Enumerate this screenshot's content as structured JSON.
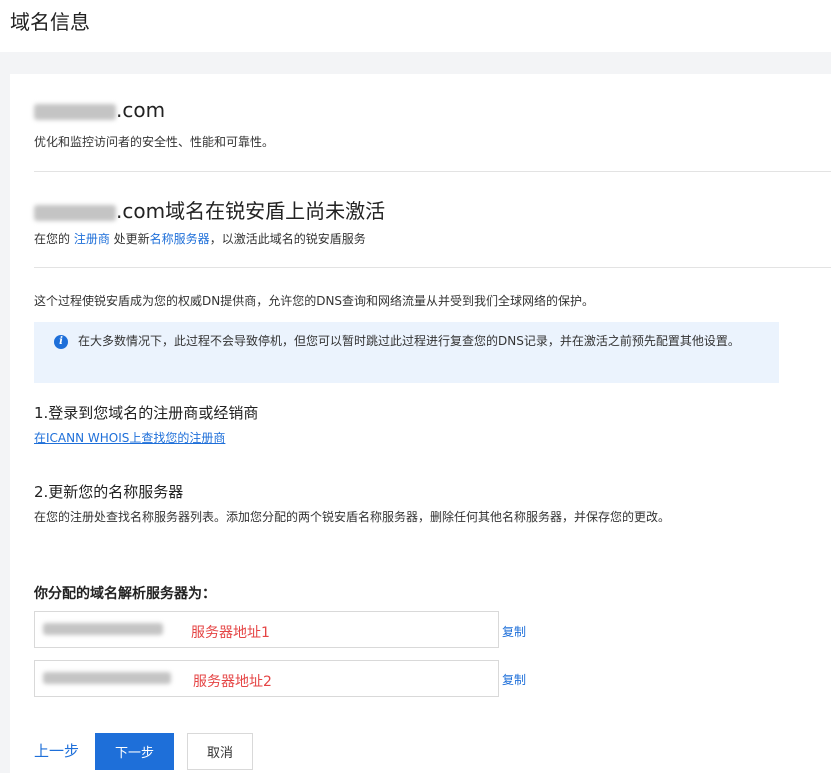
{
  "header": {
    "title": "域名信息"
  },
  "domain": {
    "name_suffix": ".com",
    "description": "优化和监控访问者的安全性、性能和可靠性。"
  },
  "status": {
    "title_suffix": ".com域名在锐安盾上尚未激活",
    "desc_prefix": "在您的 ",
    "registrar_link": "注册商",
    "desc_middle": " 处更新",
    "nameservers_link": "名称服务器",
    "desc_suffix": "，以激活此域名的锐安盾服务"
  },
  "intro": "这个过程使锐安盾成为您的权威DN提供商，允许您的DNS查询和网络流量从并受到我们全球网络的保护。",
  "notice": {
    "icon": "info-icon",
    "text": "在大多数情况下，此过程不会导致停机，但您可以暂时跳过此过程进行复查您的DNS记录，并在激活之前预先配置其他设置。"
  },
  "steps": {
    "step1_title": "1.登录到您域名的注册商或经销商",
    "step1_link": "在ICANN WHOIS上查找您的注册商",
    "step2_title": "2.更新您的名称服务器",
    "step2_desc": "在您的注册处查找名称服务器列表。添加您分配的两个锐安盾名称服务器，删除任何其他名称服务器，并保存您的更改。"
  },
  "nameservers": {
    "label": "你分配的域名解析服务器为：",
    "items": [
      {
        "note": "服务器地址1",
        "copy": "复制"
      },
      {
        "note": "服务器地址2",
        "copy": "复制"
      }
    ]
  },
  "actions": {
    "prev": "上一步",
    "next": "下一步",
    "cancel": "取消"
  },
  "colors": {
    "accent": "#1e6fd9",
    "warning_text": "#e54545",
    "notice_bg": "#ebf3fd"
  }
}
